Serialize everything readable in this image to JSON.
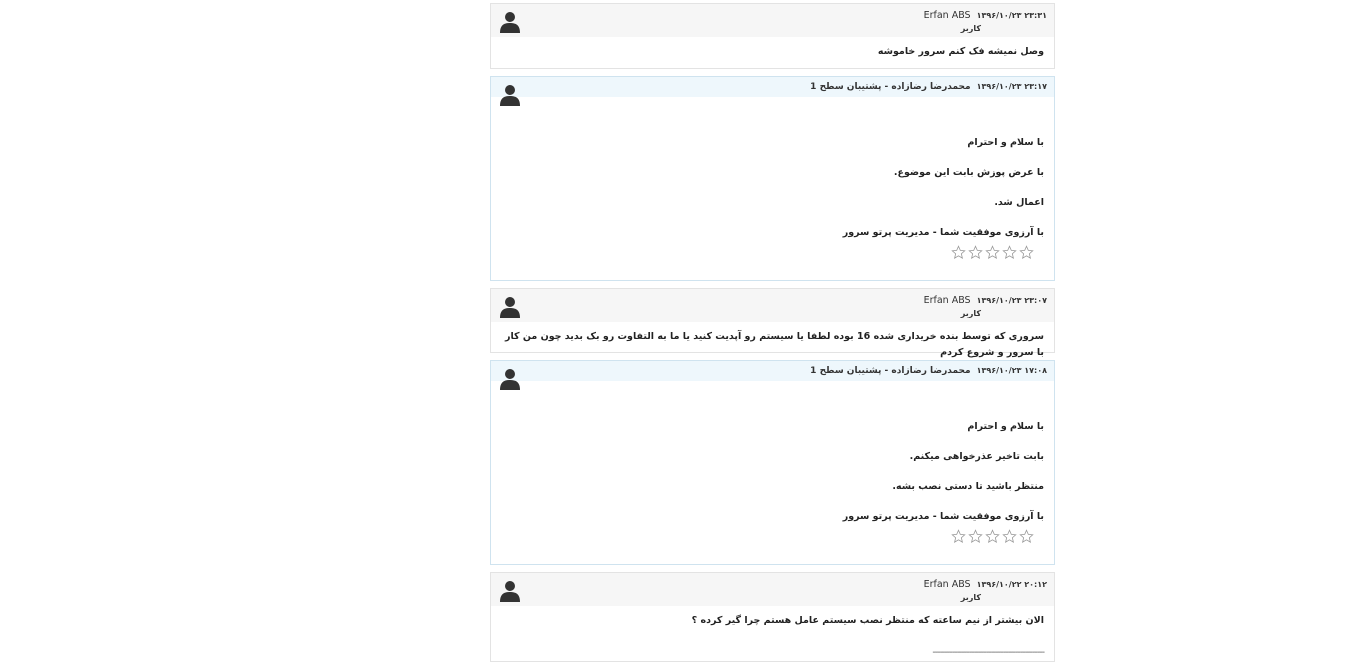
{
  "replies": [
    {
      "type": "user",
      "author": "Erfan ABS",
      "date": "۱۳۹۶/۱۰/۲۳ ۲۳:۳۱",
      "role": "کاربر",
      "body": [
        "وصل نمیشه فک کنم سرور خاموشه"
      ]
    },
    {
      "type": "staff",
      "author": "محمدرضا رضازاده - پشتیبان سطح 1",
      "date": "۱۳۹۶/۱۰/۲۳ ۲۳:۱۷",
      "body": [
        "با سلام و احترام",
        "با عرض پوزش بابت این موضوع.",
        "اعمال شد.",
        "با آرزوی موفقیت شما - مدیریت پرتو سرور"
      ],
      "rating": 0
    },
    {
      "type": "user",
      "author": "Erfan ABS",
      "date": "۱۳۹۶/۱۰/۲۳ ۲۳:۰۷",
      "role": "کاربر",
      "body": [
        "سروری که توسط بنده خریداری شده 16 بوده لطفا یا سیستم رو آپدیت کنید یا ما به التفاوت رو بک بدید چون من کار با سرور و شروع کردم"
      ]
    },
    {
      "type": "staff",
      "author": "محمدرضا رضازاده - پشتیبان سطح 1",
      "date": "۱۳۹۶/۱۰/۲۳ ۱۷:۰۸",
      "body": [
        "با سلام و احترام",
        "بابت تاخیر عذرخواهی میکنم.",
        "منتظر باشید تا دستی نصب بشه.",
        "با آرزوی موفقیت شما - مدیریت پرتو سرور"
      ],
      "rating": 0
    },
    {
      "type": "user",
      "author": "Erfan ABS",
      "date": "۱۳۹۶/۱۰/۲۲ ۲۰:۱۲",
      "role": "کاربر",
      "body": [
        "الان بیشتر از نیم ساعته که منتظر نصب سیستم عامل هستم چرا گیر کرده ؟",
        "----------------------------------------------"
      ]
    }
  ],
  "icons": {
    "avatar": "user-avatar-icon",
    "star": "star-outline-icon"
  },
  "colors": {
    "user_header": "#f6f6f6",
    "staff_header": "#eef7fc",
    "staff_border": "#cfe3ef",
    "avatar": "#333333",
    "star": "#999999"
  }
}
